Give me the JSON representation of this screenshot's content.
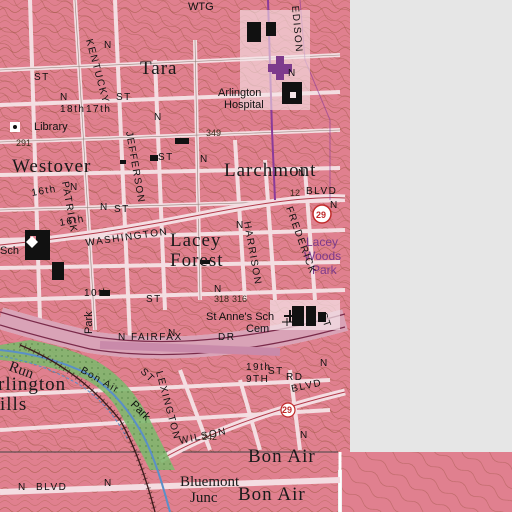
{
  "map": {
    "places": {
      "tara": "Tara",
      "westover": "Westover",
      "larchmont": "Larchmont",
      "lacey": "Lacey",
      "forest": "Forest",
      "bon_air_main": "Bon Air",
      "bon_air_bottom": "Bon Air",
      "bluemont": "Bluemont",
      "junc": "Junc",
      "arlington_top": "rlington",
      "arlington_left": "rlington",
      "ills": "ills",
      "run": "Run",
      "wtg": "WTG"
    },
    "landmarks": {
      "arlington_hospital_1": "Arlington",
      "arlington_hospital_2": "Hospital",
      "library": "Library",
      "st_annes_sch": "St Anne's Sch",
      "cem": "Cem",
      "park_left": "Park",
      "park_trail": "Park",
      "sch_left": "Sch"
    },
    "parks": {
      "lacey_woods_1": "Lacey",
      "lacey_woods_2": "Woods",
      "lacey_woods_3": "Park"
    },
    "streets": {
      "washington": "WASHINGTON",
      "n_fairfax": "N FAIRFAX",
      "dr": "DR",
      "wilson": "WILSON",
      "blvd_top": "BLVD",
      "blvd_wilson": "BLVD",
      "blvd_bottom": "BLVD",
      "harrison": "HARRISON",
      "frederick": "FREDERICK",
      "jefferson": "JEFFERSON",
      "patrick": "PATRICK",
      "kentucky": "KENTUCKY",
      "edison": "EDISON",
      "lexington": "LEXINGTON",
      "n_top": "N",
      "st_1": "ST",
      "st_2": "ST",
      "st_3": "ST",
      "st_4": "ST",
      "st_5": "ST",
      "st_6": "ST",
      "st_frederick": "ST",
      "st_lex": "ST",
      "n_1": "N",
      "n_2": "N",
      "n_3": "N",
      "n_4": "N",
      "n_5": "N",
      "n_6": "N",
      "n_7": "N",
      "n_8": "N",
      "n_9": "N",
      "n_10": "N",
      "n_11": "N",
      "n_12": "N",
      "n_13": "N",
      "n_14": "N",
      "n_15": "N",
      "s_16th_1": "16th",
      "s_16th_2": "16th",
      "s_17th": "17th",
      "s_18th": "18th",
      "s_19th": "19th",
      "s_9th": "9TH",
      "rd": "RD",
      "s_10th": "10th",
      "bon_air": "Bon Air"
    },
    "elevations": [
      "291",
      "349",
      "316",
      "318",
      "242",
      "12"
    ],
    "route_shields": [
      "29",
      "29"
    ],
    "colors": {
      "urban_tint": "#e0808f",
      "background": "#e6e6e6",
      "contours": "#9a5a3c",
      "roads": "#f7e9ec",
      "interstate": "#c1698c",
      "park_green": "#7fb86e",
      "water_blue": "#5a8fc8",
      "railroad": "#3a1a1a",
      "boundary": "#8a3a9a"
    },
    "icons": [
      "hospital-icon",
      "school-icon",
      "library-icon",
      "church-icon",
      "cemetery-icon",
      "route-shield-icon"
    ]
  }
}
